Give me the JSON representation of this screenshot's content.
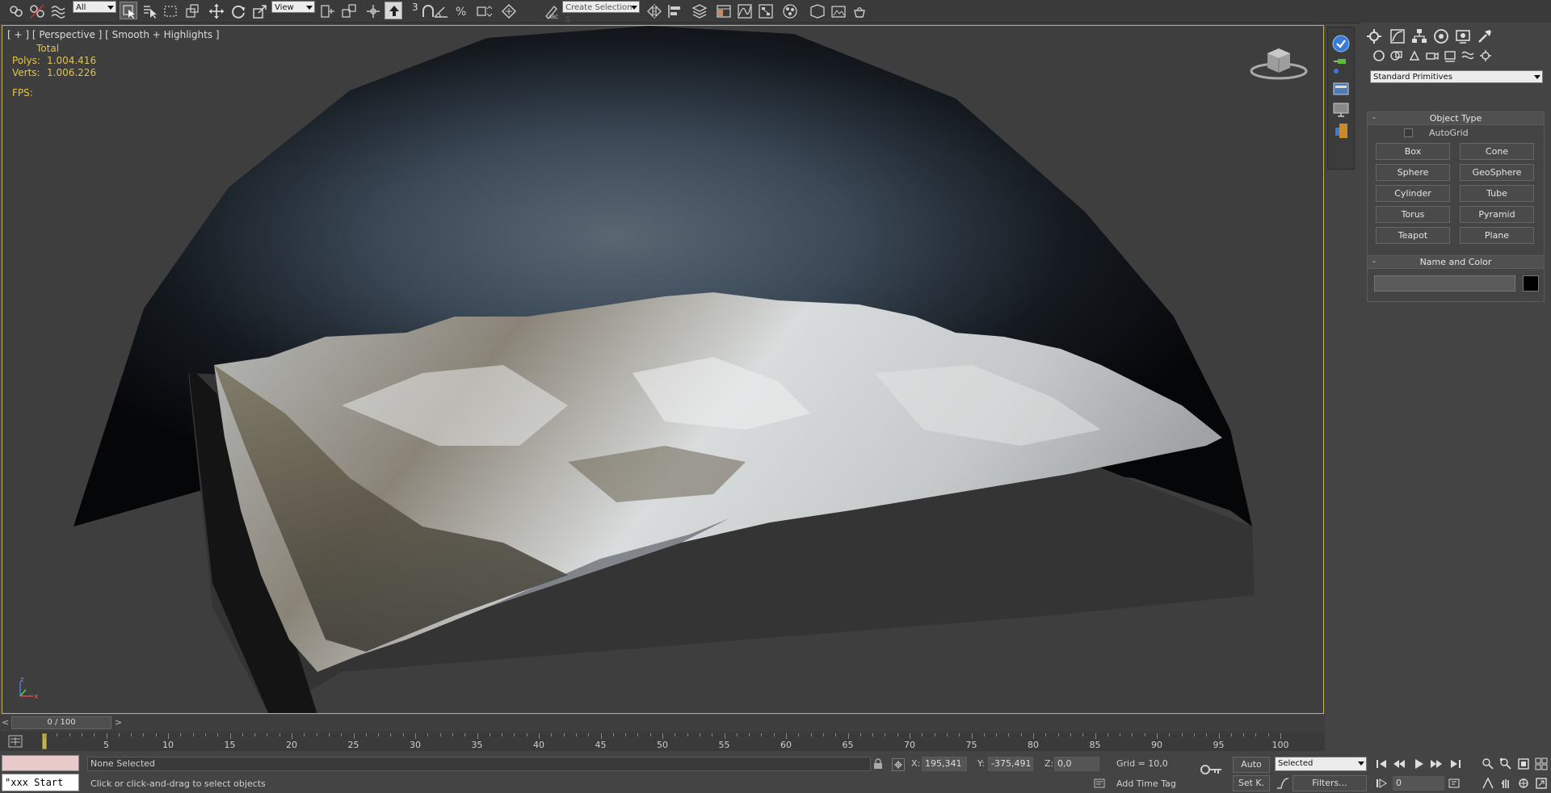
{
  "toolbar": {
    "selection_filter": "All",
    "reference_coord": "View",
    "spinner_snap_label": "3",
    "named_selection_placeholder": "Create Selection S"
  },
  "viewport": {
    "label": "[ + ] [ Perspective ] [ Smooth + Highlights ]",
    "stats_total": "Total",
    "polys_label": "Polys:",
    "polys_value": "1.004.416",
    "verts_label": "Verts:",
    "verts_value": "1.006.226",
    "fps_label": "FPS:",
    "axis_x": "x",
    "axis_y": "y",
    "axis_z": "z"
  },
  "command_panel": {
    "category_dropdown": "Standard Primitives",
    "object_type_title": "Object Type",
    "autogrid_label": "AutoGrid",
    "primitives": [
      "Box",
      "Cone",
      "Sphere",
      "GeoSphere",
      "Cylinder",
      "Tube",
      "Torus",
      "Pyramid",
      "Teapot",
      "Plane"
    ],
    "name_color_title": "Name and Color",
    "name_value": "",
    "object_color": "#000000"
  },
  "timeline": {
    "frame_counter": "0 / 100",
    "ticks": [
      "5",
      "10",
      "15",
      "20",
      "25",
      "30",
      "35",
      "40",
      "45",
      "50",
      "55",
      "60",
      "65",
      "70",
      "75",
      "80",
      "85",
      "90",
      "95",
      "100"
    ]
  },
  "status": {
    "maxscript_listener": "\"xxx Start",
    "selection_status": "None Selected",
    "prompt": "Click or click-and-drag to select objects",
    "x_label": "X:",
    "x_value": "195,341",
    "y_label": "Y:",
    "y_value": "-375,491",
    "z_label": "Z:",
    "z_value": "0,0",
    "grid": "Grid = 10,0",
    "add_time_tag": "Add Time Tag",
    "auto_key": "Auto",
    "set_key": "Set K.",
    "key_filter_selected": "Selected",
    "filters": "Filters...",
    "current_frame": "0"
  },
  "colors": {
    "viewport_border_active": "#c5b25b",
    "stats_text": "#e2c44b",
    "ui_background": "#444444"
  }
}
